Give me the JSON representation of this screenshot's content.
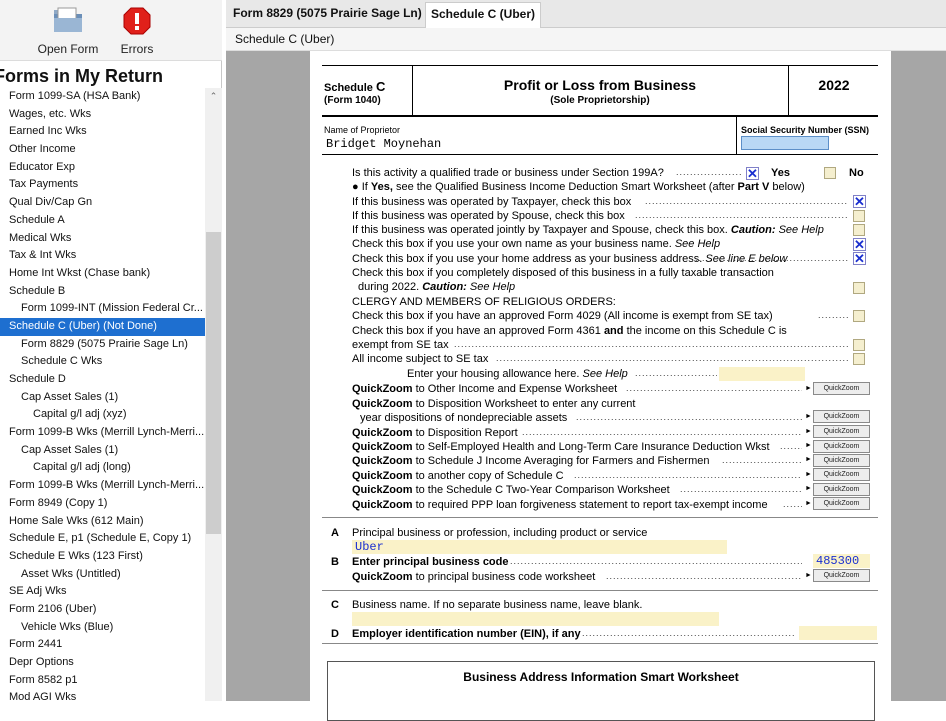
{
  "toolbar": {
    "open_form": "Open Form",
    "errors": "Errors"
  },
  "sidebar": {
    "title": "Forms in My Return",
    "items": [
      {
        "label": "Form 1099-SA (HSA Bank)",
        "indent": 0,
        "selected": false
      },
      {
        "label": "Wages, etc. Wks",
        "indent": 0,
        "selected": false
      },
      {
        "label": "Earned Inc Wks",
        "indent": 0,
        "selected": false
      },
      {
        "label": "Other Income",
        "indent": 0,
        "selected": false
      },
      {
        "label": "Educator Exp",
        "indent": 0,
        "selected": false
      },
      {
        "label": "Tax Payments",
        "indent": 0,
        "selected": false
      },
      {
        "label": "Qual Div/Cap Gn",
        "indent": 0,
        "selected": false
      },
      {
        "label": "Schedule A",
        "indent": 0,
        "selected": false
      },
      {
        "label": "Medical Wks",
        "indent": 0,
        "selected": false
      },
      {
        "label": "Tax & Int Wks",
        "indent": 0,
        "selected": false
      },
      {
        "label": "Home Int Wkst (Chase bank)",
        "indent": 0,
        "selected": false
      },
      {
        "label": "Schedule B",
        "indent": 0,
        "selected": false
      },
      {
        "label": "Form 1099-INT (Mission Federal Cr...",
        "indent": 1,
        "selected": false
      },
      {
        "label": "Schedule C (Uber) (Not Done)",
        "indent": 0,
        "selected": true
      },
      {
        "label": "Form 8829 (5075 Prairie Sage Ln)",
        "indent": 1,
        "selected": false
      },
      {
        "label": "Schedule C Wks",
        "indent": 1,
        "selected": false
      },
      {
        "label": "Schedule D",
        "indent": 0,
        "selected": false
      },
      {
        "label": "Cap Asset Sales (1)",
        "indent": 1,
        "selected": false
      },
      {
        "label": "Capital g/l adj (xyz)",
        "indent": 2,
        "selected": false
      },
      {
        "label": "Form 1099-B Wks (Merrill Lynch-Merri...",
        "indent": 0,
        "selected": false
      },
      {
        "label": "Cap Asset Sales (1)",
        "indent": 1,
        "selected": false
      },
      {
        "label": "Capital g/l adj (long)",
        "indent": 2,
        "selected": false
      },
      {
        "label": "Form 1099-B Wks (Merrill Lynch-Merri...",
        "indent": 0,
        "selected": false
      },
      {
        "label": "Form 8949 (Copy 1)",
        "indent": 0,
        "selected": false
      },
      {
        "label": "Home Sale Wks (612 Main)",
        "indent": 0,
        "selected": false
      },
      {
        "label": "Schedule E, p1 (Schedule E, Copy 1)",
        "indent": 0,
        "selected": false
      },
      {
        "label": "Schedule E Wks (123 First)",
        "indent": 0,
        "selected": false
      },
      {
        "label": "Asset Wks (Untitled)",
        "indent": 1,
        "selected": false
      },
      {
        "label": "SE Adj Wks",
        "indent": 0,
        "selected": false
      },
      {
        "label": "Form 2106 (Uber)",
        "indent": 0,
        "selected": false
      },
      {
        "label": "Vehicle Wks (Blue)",
        "indent": 1,
        "selected": false
      },
      {
        "label": "Form 2441",
        "indent": 0,
        "selected": false
      },
      {
        "label": "Depr Options",
        "indent": 0,
        "selected": false
      },
      {
        "label": "Form 8582 p1",
        "indent": 0,
        "selected": false
      },
      {
        "label": "Mod AGI Wks",
        "indent": 0,
        "selected": false
      }
    ]
  },
  "tabs": [
    {
      "label": "Form 8829 (5075 Prairie Sage Ln)",
      "active": false
    },
    {
      "label": "Schedule C (Uber)",
      "active": true
    }
  ],
  "subheader": "Schedule C (Uber)",
  "form": {
    "sched_label": "Schedule",
    "sched_letter": "C",
    "form_ref": "(Form 1040)",
    "title": "Profit or Loss from Business",
    "subtitle": "(Sole Proprietorship)",
    "year": "2022",
    "name_label": "Name of Proprietor",
    "name_value": "Bridget Moynehan",
    "ssn_label": "Social Security Number (SSN)",
    "q199a": "Is this activity a qualified trade or business under Section 199A?",
    "yes": "Yes",
    "no": "No",
    "if_yes_a": "If ",
    "if_yes_b": "Yes,",
    "if_yes_c": " see the Qualified Business Income Deduction Smart Worksheet (after ",
    "if_yes_d": "Part V",
    "if_yes_e": " below)",
    "l_taxpayer": "If this business was operated by Taxpayer, check this box",
    "l_spouse": "If this business was operated by Spouse, check this box",
    "l_joint": "If this business was operated jointly by Taxpayer and Spouse, check this box.",
    "caution": "Caution:",
    "see_help": "See Help",
    "l_ownname": "Check this box if you use your own name as your business name.",
    "l_homeaddr": "Check this box if you use your home address as your business address.",
    "see_line_e": "See line E below",
    "l_disposed1": "Check this box if you completely disposed of this business in a fully taxable transaction",
    "l_disposed2": "during 2022.",
    "l_clergy": "CLERGY AND MEMBERS OF RELIGIOUS ORDERS:",
    "l_4029": "Check this box if you have an approved Form 4029 (All income is exempt from SE tax)",
    "l_4361a": "Check this box if you have an approved Form 4361",
    "l_and": "and",
    "l_4361b": "the income on this Schedule C is",
    "l_exempt": "exempt from SE tax",
    "l_allse": "All income subject to SE tax",
    "l_housing": "Enter your housing allowance here.",
    "qz_word": "QuickZoom",
    "qz_btn": "QuickZoom",
    "qz1": "to Other Income and Expense Worksheet",
    "qz2a": "to Disposition Worksheet to enter any current",
    "qz2b": "year dispositions of nondepreciable assets",
    "qz3": "to Disposition Report",
    "qz4": "to Self-Employed Health and Long-Term Care Insurance Deduction Wkst",
    "qz5": "to Schedule J Income Averaging for Farmers and Fishermen",
    "qz6": "to another copy of Schedule C",
    "qz7": "to the Schedule C Two-Year Comparison Worksheet",
    "qz8": "to required PPP loan forgiveness statement to report tax-exempt income",
    "A_letter": "A",
    "A_label": "Principal business or profession, including product or service",
    "A_value": "Uber",
    "B_letter": "B",
    "B_label": "Enter principal business code",
    "B_value": "485300",
    "B_qz": "to principal business code worksheet",
    "C_letter": "C",
    "C_label": "Business name. If no separate business name, leave blank.",
    "D_letter": "D",
    "D_label": "Employer identification number (EIN), if any",
    "smart_ws": "Business Address Information Smart Worksheet"
  }
}
